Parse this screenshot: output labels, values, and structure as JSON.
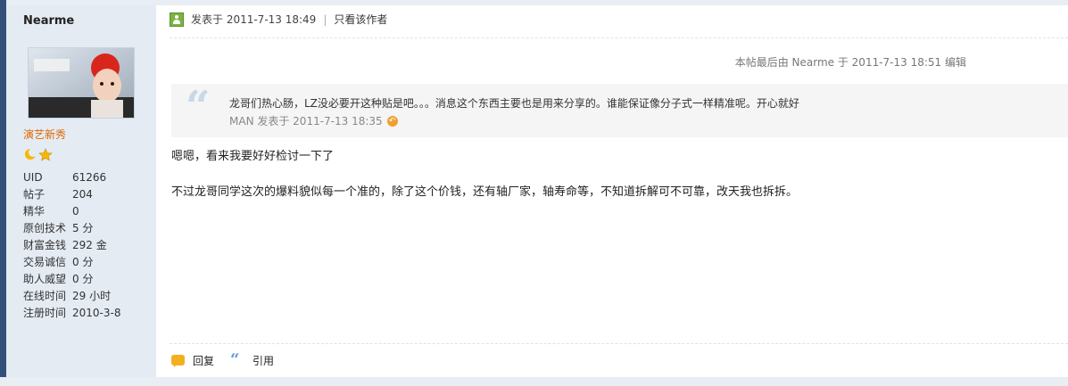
{
  "sidebar": {
    "username": "Nearme",
    "rank": "演艺新秀",
    "stats": [
      {
        "label": "UID",
        "value": "61266"
      },
      {
        "label": "帖子",
        "value": "204"
      },
      {
        "label": "精华",
        "value": "0"
      },
      {
        "label": "原创技术",
        "value": "5 分"
      },
      {
        "label": "财富金钱",
        "value": "292 金"
      },
      {
        "label": "交易诚信",
        "value": "0 分"
      },
      {
        "label": "助人威望",
        "value": "0 分"
      },
      {
        "label": "在线时间",
        "value": "29 小时"
      },
      {
        "label": "注册时间",
        "value": "2010-3-8"
      }
    ],
    "stars": [
      "moon-icon",
      "star-icon"
    ]
  },
  "post": {
    "posted_at": "发表于  2011-7-13 18:49",
    "author_only": "只看该作者",
    "last_edit": "本帖最后由  Nearme  于  2011-7-13 18:51 编辑",
    "quote": {
      "text": "龙哥们热心肠，LZ没必要开这种贴是吧。。。消息这个东西主要也是用来分享的。谁能保证像分子式一样精准呢。开心就好",
      "meta": "MAN 发表于  2011-7-13 18:35"
    },
    "paragraphs": [
      "嗯嗯，看来我要好好检讨一下了",
      "不过龙哥同学这次的爆料貌似每一个准的，除了这个价钱，还有轴厂家，轴寿命等，不知道拆解可不可靠，改天我也拆拆。"
    ]
  },
  "actions": {
    "reply": "回复",
    "cite": "引用"
  },
  "colors": {
    "sidebar_bg": "#e4ebf3",
    "rank": "#e06a00",
    "accent": "#33507a"
  }
}
